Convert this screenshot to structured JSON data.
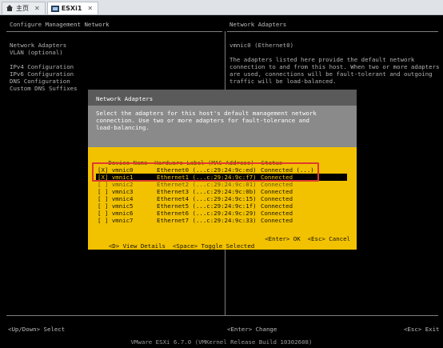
{
  "tabs": [
    {
      "label": "主页",
      "icon": "home-icon",
      "active": false
    },
    {
      "label": "ESXi1",
      "icon": "vm-icon",
      "active": true
    }
  ],
  "left_pane": {
    "title": "Configure Management Network",
    "menu": [
      "Network Adapters",
      "VLAN (optional)",
      "",
      "IPv4 Configuration",
      "IPv6 Configuration",
      "DNS Configuration",
      "Custom DNS Suffixes"
    ]
  },
  "right_pane": {
    "title": "Network Adapters",
    "lines": [
      "vmnic0 (Ethernet0)",
      "",
      "The adapters listed here provide the default network",
      "connection to and from this host. When two or more adapters",
      "are used, connections will be fault-tolerant and outgoing",
      "traffic will be load-balanced."
    ]
  },
  "dialog": {
    "title": "Network Adapters",
    "desc": [
      "Select the adapters for this host's default management network",
      "connection. Use two or more adapters for fault-tolerance and",
      "load-balancing."
    ],
    "header": "   Device Name  Hardware Label (MAC Address)  Status",
    "rows": [
      {
        "check": "[X]",
        "device": "vmnic0",
        "hw": "Ethernet0 (...c:29:24:9c:ed)",
        "status": "Connected (...)"
      },
      {
        "check": "[X]",
        "device": "vmnic1",
        "hw": "Ethernet1 (...c:29:24:9c:f7)",
        "status": "Connected"
      },
      {
        "check": "[ ]",
        "device": "vmnic2",
        "hw": "Ethernet2 (...c:29:24:9c:01)",
        "status": "Connected"
      },
      {
        "check": "[ ]",
        "device": "vmnic3",
        "hw": "Ethernet3 (...c:29:24:9c:0b)",
        "status": "Connected"
      },
      {
        "check": "[ ]",
        "device": "vmnic4",
        "hw": "Ethernet4 (...c:29:24:9c:15)",
        "status": "Connected"
      },
      {
        "check": "[ ]",
        "device": "vmnic5",
        "hw": "Ethernet5 (...c:29:24:9c:1f)",
        "status": "Connected"
      },
      {
        "check": "[ ]",
        "device": "vmnic6",
        "hw": "Ethernet6 (...c:29:24:9c:29)",
        "status": "Connected"
      },
      {
        "check": "[ ]",
        "device": "vmnic7",
        "hw": "Ethernet7 (...c:29:24:9c:33)",
        "status": "Connected"
      }
    ],
    "view_details": "<D> View Details",
    "toggle": "<Space> Toggle Selected",
    "ok": "<Enter> OK",
    "cancel": "<Esc> Cancel"
  },
  "bottom": {
    "select": "<Up/Down> Select",
    "change": "<Enter> Change",
    "exit": "<Esc> Exit"
  },
  "footer": "VMware ESXi 6.7.0 (VMKernel Release Build 10302608)",
  "colors": {
    "dialog_bg": "#f2c200",
    "highlight": "#e03a2e"
  }
}
